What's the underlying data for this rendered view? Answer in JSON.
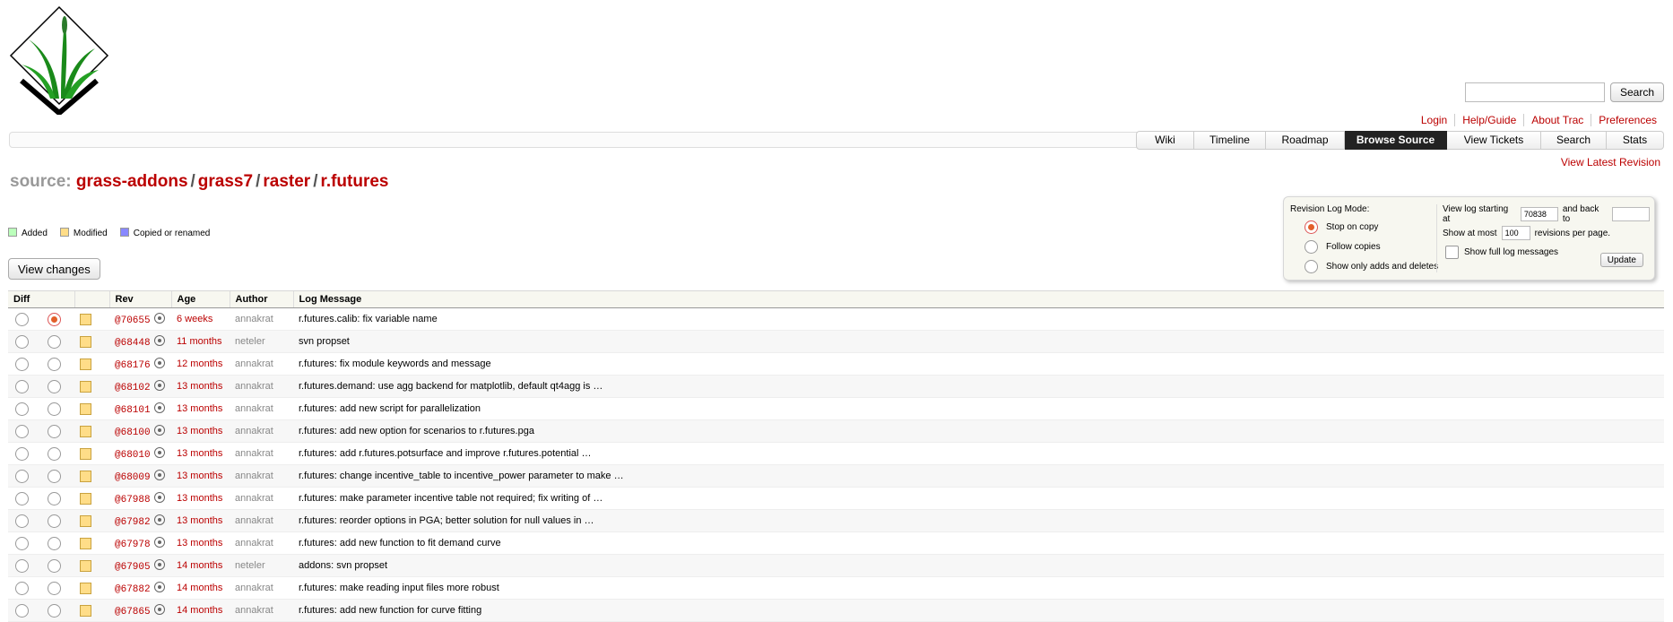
{
  "search": {
    "placeholder": "",
    "button": "Search"
  },
  "metanav": [
    "Login",
    "Help/Guide",
    "About Trac",
    "Preferences"
  ],
  "mainnav": [
    {
      "label": "Wiki",
      "active": false
    },
    {
      "label": "Timeline",
      "active": false
    },
    {
      "label": "Roadmap",
      "active": false
    },
    {
      "label": "Browse Source",
      "active": true
    },
    {
      "label": "View Tickets",
      "active": false
    },
    {
      "label": "Search",
      "active": false
    },
    {
      "label": "Stats",
      "active": false
    }
  ],
  "ctxtnav": {
    "latest": "View Latest Revision"
  },
  "path": {
    "prefix": "source:",
    "parts": [
      "grass-addons",
      "grass7",
      "raster",
      "r.futures"
    ]
  },
  "legend": {
    "added": "Added",
    "modified": "Modified",
    "copied": "Copied or renamed"
  },
  "colors": {
    "added": "#bfb",
    "modified": "#fd8",
    "copied": "#88f"
  },
  "view_changes": "View changes",
  "prefs": {
    "mode_label": "Revision Log Mode:",
    "modes": [
      {
        "label": "Stop on copy",
        "selected": true
      },
      {
        "label": "Follow copies",
        "selected": false
      },
      {
        "label": "Show only adds and deletes",
        "selected": false
      }
    ],
    "view_log_label": "View log starting at",
    "start_rev": "70838",
    "back_to_label": "and back to",
    "back_to": "",
    "show_at_most_label": "Show at most",
    "limit": "100",
    "revisions_per_page": "revisions per page.",
    "full_messages": "Show full log messages",
    "update": "Update"
  },
  "table": {
    "headers": [
      "Diff",
      "",
      "Rev",
      "Age",
      "Author",
      "Log Message"
    ],
    "rows": [
      {
        "rev": "@70655",
        "age": "6 weeks",
        "author": "annakrat",
        "msg": "r.futures.calib: fix variable name"
      },
      {
        "rev": "@68448",
        "age": "11 months",
        "author": "neteler",
        "msg": "svn propset"
      },
      {
        "rev": "@68176",
        "age": "12 months",
        "author": "annakrat",
        "msg": "r.futures: fix module keywords and message"
      },
      {
        "rev": "@68102",
        "age": "13 months",
        "author": "annakrat",
        "msg": "r.futures.demand: use agg backend for matplotlib, default qt4agg is …"
      },
      {
        "rev": "@68101",
        "age": "13 months",
        "author": "annakrat",
        "msg": "r.futures: add new script for parallelization"
      },
      {
        "rev": "@68100",
        "age": "13 months",
        "author": "annakrat",
        "msg": "r.futures: add new option for scenarios to r.futures.pga"
      },
      {
        "rev": "@68010",
        "age": "13 months",
        "author": "annakrat",
        "msg": "r.futures: add r.futures.potsurface and improve r.futures.potential …"
      },
      {
        "rev": "@68009",
        "age": "13 months",
        "author": "annakrat",
        "msg": "r.futures: change incentive_table to incentive_power parameter to make …"
      },
      {
        "rev": "@67988",
        "age": "13 months",
        "author": "annakrat",
        "msg": "r.futures: make parameter incentive table not required; fix writing of …"
      },
      {
        "rev": "@67982",
        "age": "13 months",
        "author": "annakrat",
        "msg": "r.futures: reorder options in PGA; better solution for null values in …"
      },
      {
        "rev": "@67978",
        "age": "13 months",
        "author": "annakrat",
        "msg": "r.futures: add new function to fit demand curve"
      },
      {
        "rev": "@67905",
        "age": "14 months",
        "author": "neteler",
        "msg": "addons: svn propset"
      },
      {
        "rev": "@67882",
        "age": "14 months",
        "author": "annakrat",
        "msg": "r.futures: make reading input files more robust"
      },
      {
        "rev": "@67865",
        "age": "14 months",
        "author": "annakrat",
        "msg": "r.futures: add new function for curve fitting"
      }
    ]
  }
}
